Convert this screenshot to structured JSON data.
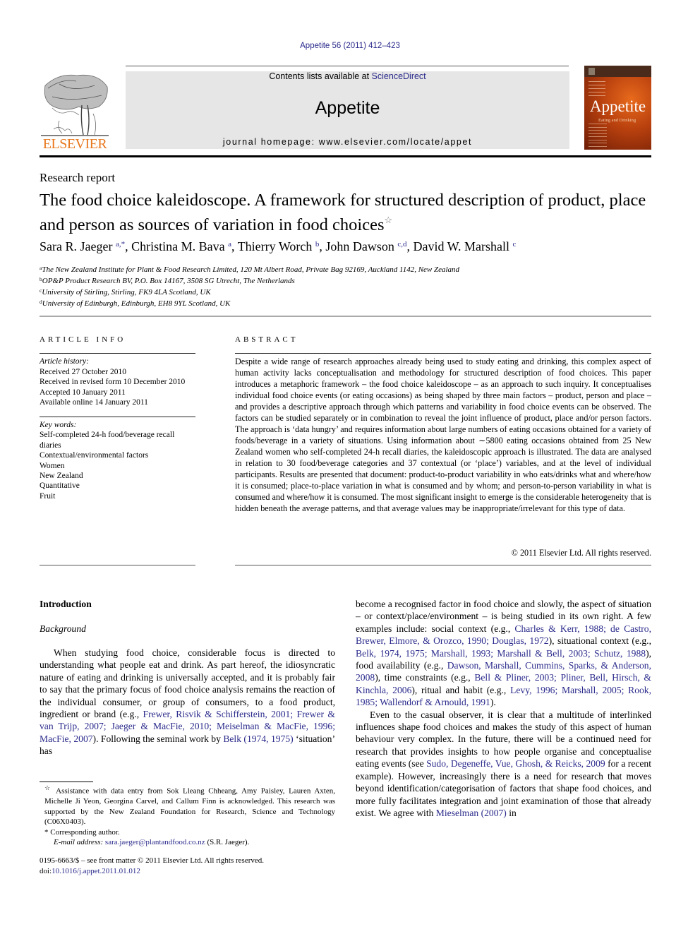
{
  "journal_ref": "Appetite 56 (2011) 412–423",
  "masthead": {
    "publisher_logo": "ELSEVIER",
    "contents_prefix": "Contents lists available at ",
    "contents_link": "ScienceDirect",
    "journal_title": "Appetite",
    "homepage": "journal homepage: www.elsevier.com/locate/appet",
    "cover_title": "Appetite",
    "cover_subtitle": "Eating and Drinking"
  },
  "colors": {
    "link": "#2a2a8c",
    "elsevier_orange": "#e8781e",
    "masthead_bg": "#e6e6e6"
  },
  "article": {
    "type": "Research report",
    "title": "The food choice kaleidoscope. A framework for structured description of product, place and person as sources of variation in food choices",
    "title_mark": "☆",
    "authors": [
      {
        "name": "Sara R. Jaeger",
        "sup": "a,*",
        "sep": ", "
      },
      {
        "name": "Christina M. Bava",
        "sup": "a",
        "sep": ", "
      },
      {
        "name": "Thierry Worch",
        "sup": "b",
        "sep": ", "
      },
      {
        "name": "John Dawson",
        "sup": "c,d",
        "sep": ", "
      },
      {
        "name": "David W. Marshall",
        "sup": "c",
        "sep": ""
      }
    ],
    "affiliations": [
      {
        "mark": "a",
        "text": "The New Zealand Institute for Plant & Food Research Limited, 120 Mt Albert Road, Private Bag 92169, Auckland 1142, New Zealand"
      },
      {
        "mark": "b",
        "text": "OP&P Product Research BV, P.O. Box 14167, 3508 SG Utrecht, The Netherlands"
      },
      {
        "mark": "c",
        "text": "University of Stirling, Stirling, FK9 4LA Scotland, UK"
      },
      {
        "mark": "d",
        "text": "University of Edinburgh, Edinburgh, EH8 9YL Scotland, UK"
      }
    ]
  },
  "article_info": {
    "heading": "ARTICLE INFO",
    "history_label": "Article history:",
    "history": [
      "Received 27 October 2010",
      "Received in revised form 10 December 2010",
      "Accepted 10 January 2011",
      "Available online 14 January 2011"
    ],
    "keywords_label": "Key words:",
    "keywords": [
      "Self-completed 24-h food/beverage recall diaries",
      "Contextual/environmental factors",
      "Women",
      "New Zealand",
      "Quantitative",
      "Fruit"
    ]
  },
  "abstract": {
    "heading": "ABSTRACT",
    "text": "Despite a wide range of research approaches already being used to study eating and drinking, this complex aspect of human activity lacks conceptualisation and methodology for structured description of food choices. This paper introduces a metaphoric framework – the food choice kaleidoscope – as an approach to such inquiry. It conceptualises individual food choice events (or eating occasions) as being shaped by three main factors – product, person and place – and provides a descriptive approach through which patterns and variability in food choice events can be observed. The factors can be studied separately or in combination to reveal the joint influence of product, place and/or person factors. The approach is ‘data hungry’ and requires information about large numbers of eating occasions obtained for a variety of foods/beverage in a variety of situations. Using information about ∼5800 eating occasions obtained from 25 New Zealand women who self-completed 24-h recall diaries, the kaleidoscopic approach is illustrated. The data are analysed in relation to 30 food/beverage categories and 37 contextual (or ‘place’) variables, and at the level of individual participants. Results are presented that document: product-to-product variability in who eats/drinks what and where/how it is consumed; place-to-place variation in what is consumed and by whom; and person-to-person variability in what is consumed and where/how it is consumed. The most significant insight to emerge is the considerable heterogeneity that is hidden beneath the average patterns, and that average values may be inappropriate/irrelevant for this type of data.",
    "copyright": "© 2011 Elsevier Ltd. All rights reserved."
  },
  "body": {
    "section_heading": "Introduction",
    "subsection_heading": "Background",
    "left_paragraph": [
      {
        "t": "When studying food choice, considerable focus is directed to understanding what people eat and drink. As part hereof, the idiosyncratic nature of eating and drinking is universally accepted, and it is probably fair to say that the primary focus of food choice analysis remains the reaction of the individual consumer, or group of consumers, to a food product, ingredient or brand (e.g., "
      },
      {
        "link": "Frewer, Risvik & Schifferstein, 2001; Frewer & van Trijp, 2007; Jaeger & MacFie, 2010; Meiselman & MacFie, 1996; MacFie, 2007"
      },
      {
        "t": "). Following the seminal work by "
      },
      {
        "link": "Belk (1974, 1975)"
      },
      {
        "t": " ‘situation’ has"
      }
    ],
    "right_paragraph_1": [
      {
        "t": "become a recognised factor in food choice and slowly, the aspect of situation – or context/place/environment – is being studied in its own right. A few examples include: social context (e.g., "
      },
      {
        "link": "Charles & Kerr, 1988; de Castro, Brewer, Elmore, & Orozco, 1990; Douglas, 1972"
      },
      {
        "t": "), situational context (e.g., "
      },
      {
        "link": "Belk, 1974, 1975; Marshall, 1993; Marshall & Bell, 2003; Schutz, 1988"
      },
      {
        "t": "), food availability (e.g., "
      },
      {
        "link": "Dawson, Marshall, Cummins, Sparks, & Anderson, 2008"
      },
      {
        "t": "), time constraints (e.g., "
      },
      {
        "link": "Bell & Pliner, 2003; Pliner, Bell, Hirsch, & Kinchla, 2006"
      },
      {
        "t": "), ritual and habit (e.g., "
      },
      {
        "link": "Levy, 1996; Marshall, 2005; Rook, 1985; Wallendorf & Arnould, 1991"
      },
      {
        "t": ")."
      }
    ],
    "right_paragraph_2": [
      {
        "t": "Even to the casual observer, it is clear that a multitude of interlinked influences shape food choices and makes the study of this aspect of human behaviour very complex. In the future, there will be a continued need for research that provides insights to how people organise and conceptualise eating events (see "
      },
      {
        "link": "Sudo, Degeneffe, Vue, Ghosh, & Reicks, 2009"
      },
      {
        "t": " for a recent example). However, increasingly there is a need for research that moves beyond identification/categorisation of factors that shape food choices, and more fully facilitates integration and joint examination of those that already exist. We agree with "
      },
      {
        "link": "Mieselman (2007)"
      },
      {
        "t": " in"
      }
    ]
  },
  "footnotes": {
    "star_mark": "☆",
    "star_text": "Assistance with data entry from Sok Lleang Chheang, Amy Paisley, Lauren Axten, Michelle Ji Yeon, Georgina Carvel, and Callum Finn is acknowledged. This research was supported by the New Zealand Foundation for Research, Science and Technology (C06X0403).",
    "corresponding_mark": "*",
    "corresponding_text": "Corresponding author.",
    "email_label": "E-mail address:",
    "email": "sara.jaeger@plantandfood.co.nz",
    "email_suffix": " (S.R. Jaeger).",
    "front_matter": "0195-6663/$ – see front matter © 2011 Elsevier Ltd. All rights reserved.",
    "doi_label": "doi:",
    "doi": "10.1016/j.appet.2011.01.012"
  }
}
